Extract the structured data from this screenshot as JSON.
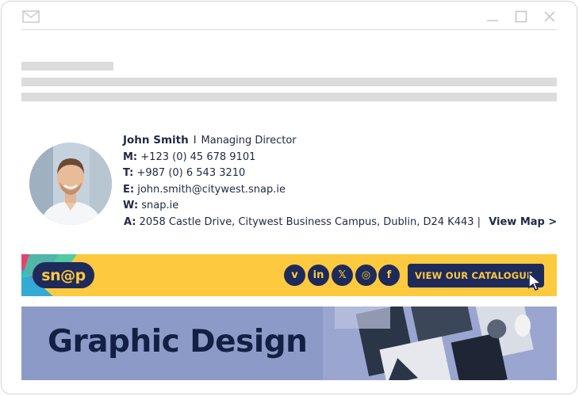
{
  "window": {
    "icons": [
      "mail-icon",
      "minimize-icon",
      "maximize-icon",
      "close-icon"
    ]
  },
  "signature": {
    "name": "John Smith",
    "separator": "I",
    "title": "Managing Director",
    "mobile_label": "M:",
    "mobile": "+123 (0) 45 678 9101",
    "tel_label": "T:",
    "tel": "+987 (0) 6 543 3210",
    "email_label": "E:",
    "email": "john.smith@citywest.snap.ie",
    "web_label": "W:",
    "web": "snap.ie",
    "address_label": "A:",
    "address": "2058 Castle Drive, Citywest Business Campus, Dublin, D24 K443",
    "address_sep": "|",
    "map_link": "View Map >"
  },
  "banner": {
    "logo": "sn@p",
    "social": [
      {
        "icon": "vimeo-icon",
        "glyph": "v"
      },
      {
        "icon": "linkedin-icon",
        "glyph": "in"
      },
      {
        "icon": "x-icon",
        "glyph": "𝕏"
      },
      {
        "icon": "instagram-icon",
        "glyph": "◎"
      },
      {
        "icon": "facebook-icon",
        "glyph": "f"
      }
    ],
    "cta": "VIEW OUR CATALOGUE",
    "colors": {
      "yellow": "#fdc93f",
      "navy": "#1e2a5a"
    }
  },
  "promo": {
    "headline": "Graphic Design",
    "background": "#8c9ac8"
  }
}
